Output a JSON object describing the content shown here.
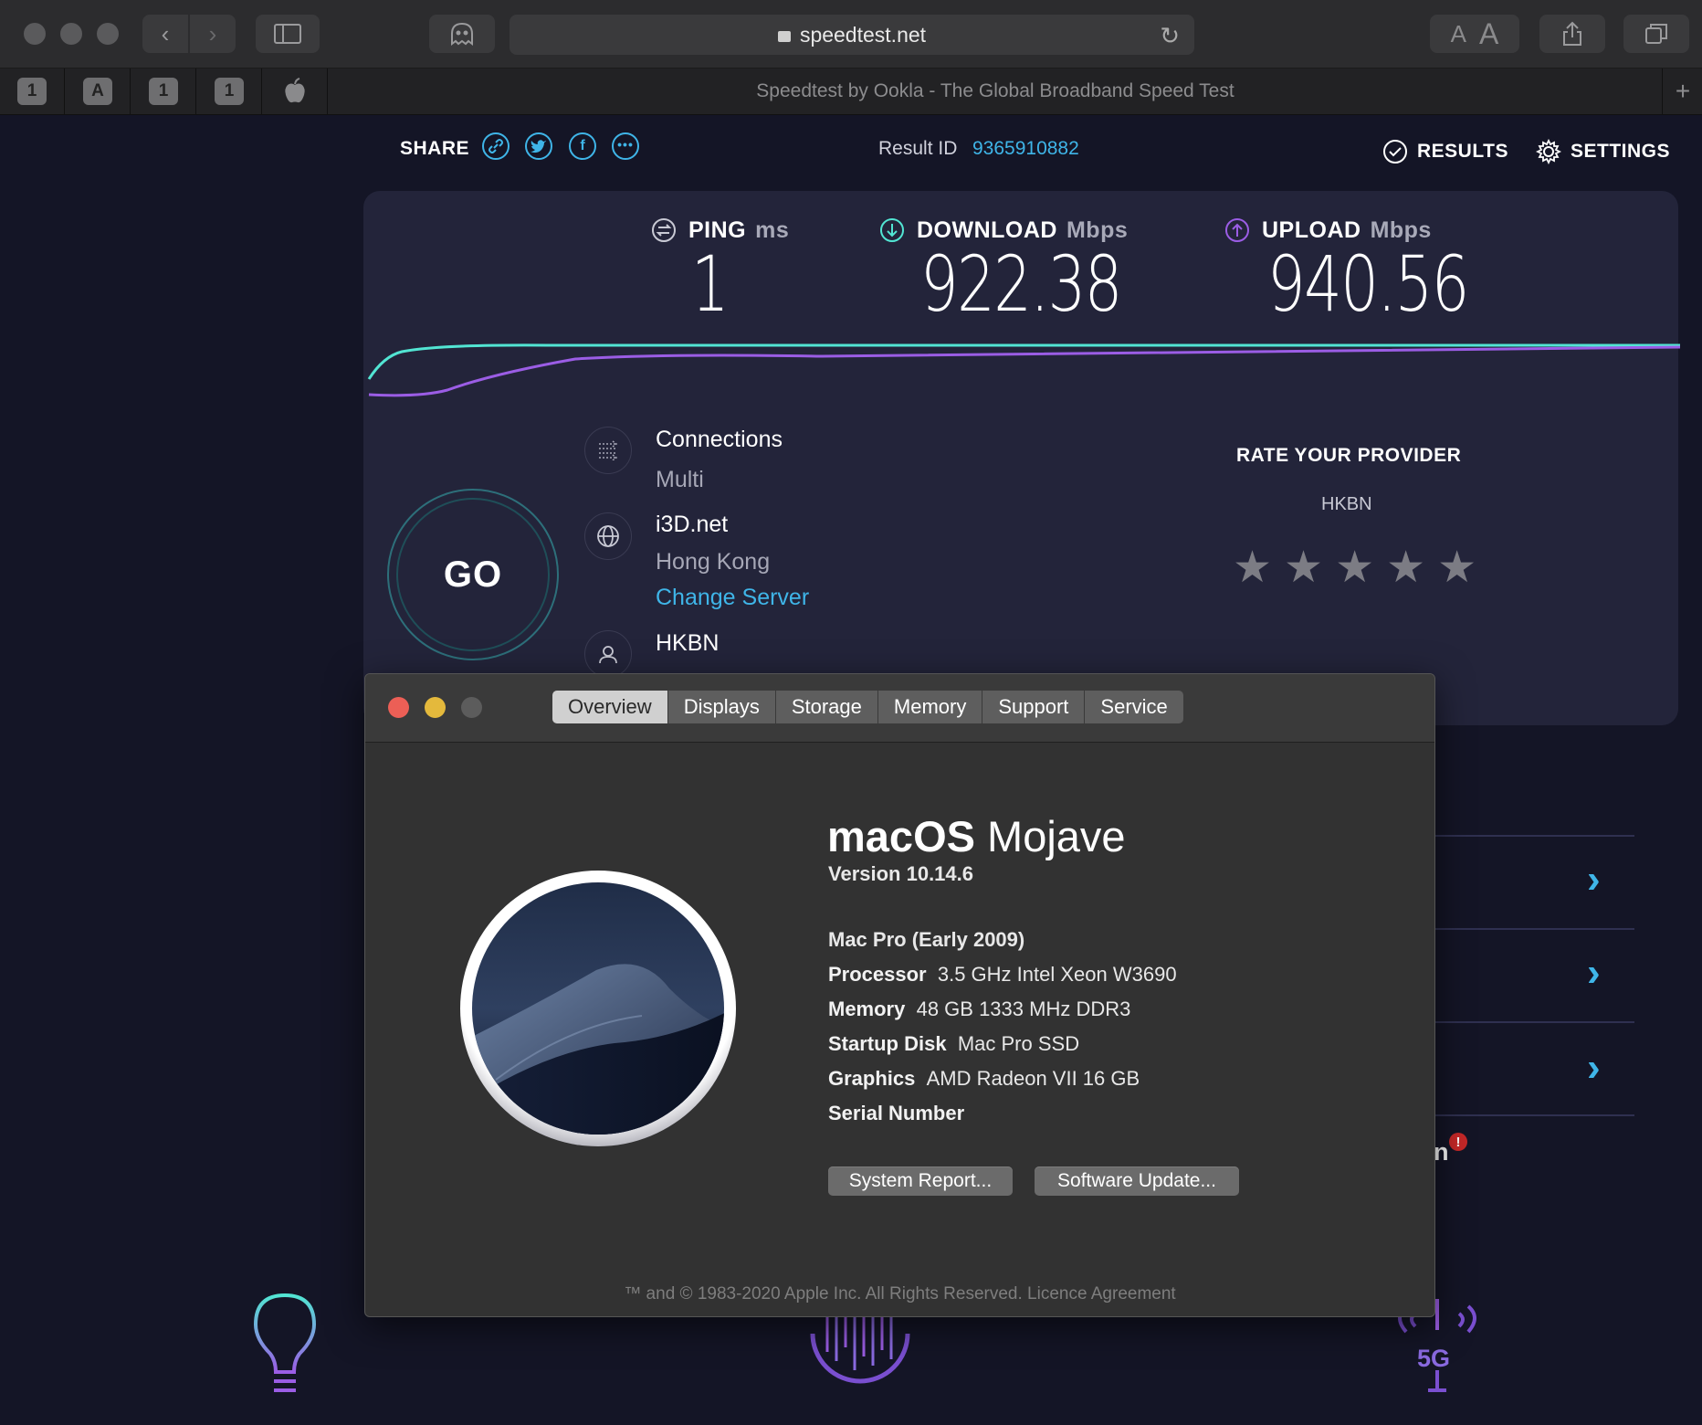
{
  "browser": {
    "url": "speedtest.net",
    "tab_icons": [
      "1",
      "A",
      "1",
      "1"
    ],
    "tab_title": "Speedtest by Ookla - The Global Broadband Speed Test",
    "text_size_labels": [
      "A",
      "A"
    ]
  },
  "speedtest": {
    "share_label": "SHARE",
    "result_id_label": "Result ID",
    "result_id": "9365910882",
    "results_label": "RESULTS",
    "settings_label": "SETTINGS",
    "ping": {
      "label": "PING",
      "unit": "ms",
      "value": "1"
    },
    "download": {
      "label": "DOWNLOAD",
      "unit": "Mbps",
      "value": "922.38"
    },
    "upload": {
      "label": "UPLOAD",
      "unit": "Mbps",
      "value": "940.56"
    },
    "go_label": "GO",
    "connections_label": "Connections",
    "connections_value": "Multi",
    "server_name": "i3D.net",
    "server_location": "Hong Kong",
    "change_server": "Change Server",
    "isp": "HKBN",
    "rate_title": "RATE YOUR PROVIDER",
    "rate_provider": "HKBN",
    "rating_stars": 5,
    "partial_text": "n",
    "colors": {
      "accent": "#3fb5e8",
      "download": "#52e5d3",
      "upload": "#9b5de5"
    }
  },
  "about_mac": {
    "tabs": [
      "Overview",
      "Displays",
      "Storage",
      "Memory",
      "Support",
      "Service"
    ],
    "selected_tab": "Overview",
    "os_name_bold": "macOS",
    "os_name_light": "Mojave",
    "version": "Version 10.14.6",
    "model": "Mac Pro (Early 2009)",
    "specs": [
      {
        "label": "Processor",
        "value": "3.5 GHz Intel Xeon W3690"
      },
      {
        "label": "Memory",
        "value": "48 GB 1333 MHz DDR3"
      },
      {
        "label": "Startup Disk",
        "value": "Mac Pro SSD"
      },
      {
        "label": "Graphics",
        "value": "AMD Radeon VII 16 GB"
      },
      {
        "label": "Serial Number",
        "value": ""
      }
    ],
    "system_report_btn": "System Report...",
    "software_update_btn": "Software Update...",
    "footer": "™ and © 1983-2020 Apple Inc. All Rights Reserved. Licence Agreement"
  },
  "bottom": {
    "fiveg_label": "5G"
  }
}
